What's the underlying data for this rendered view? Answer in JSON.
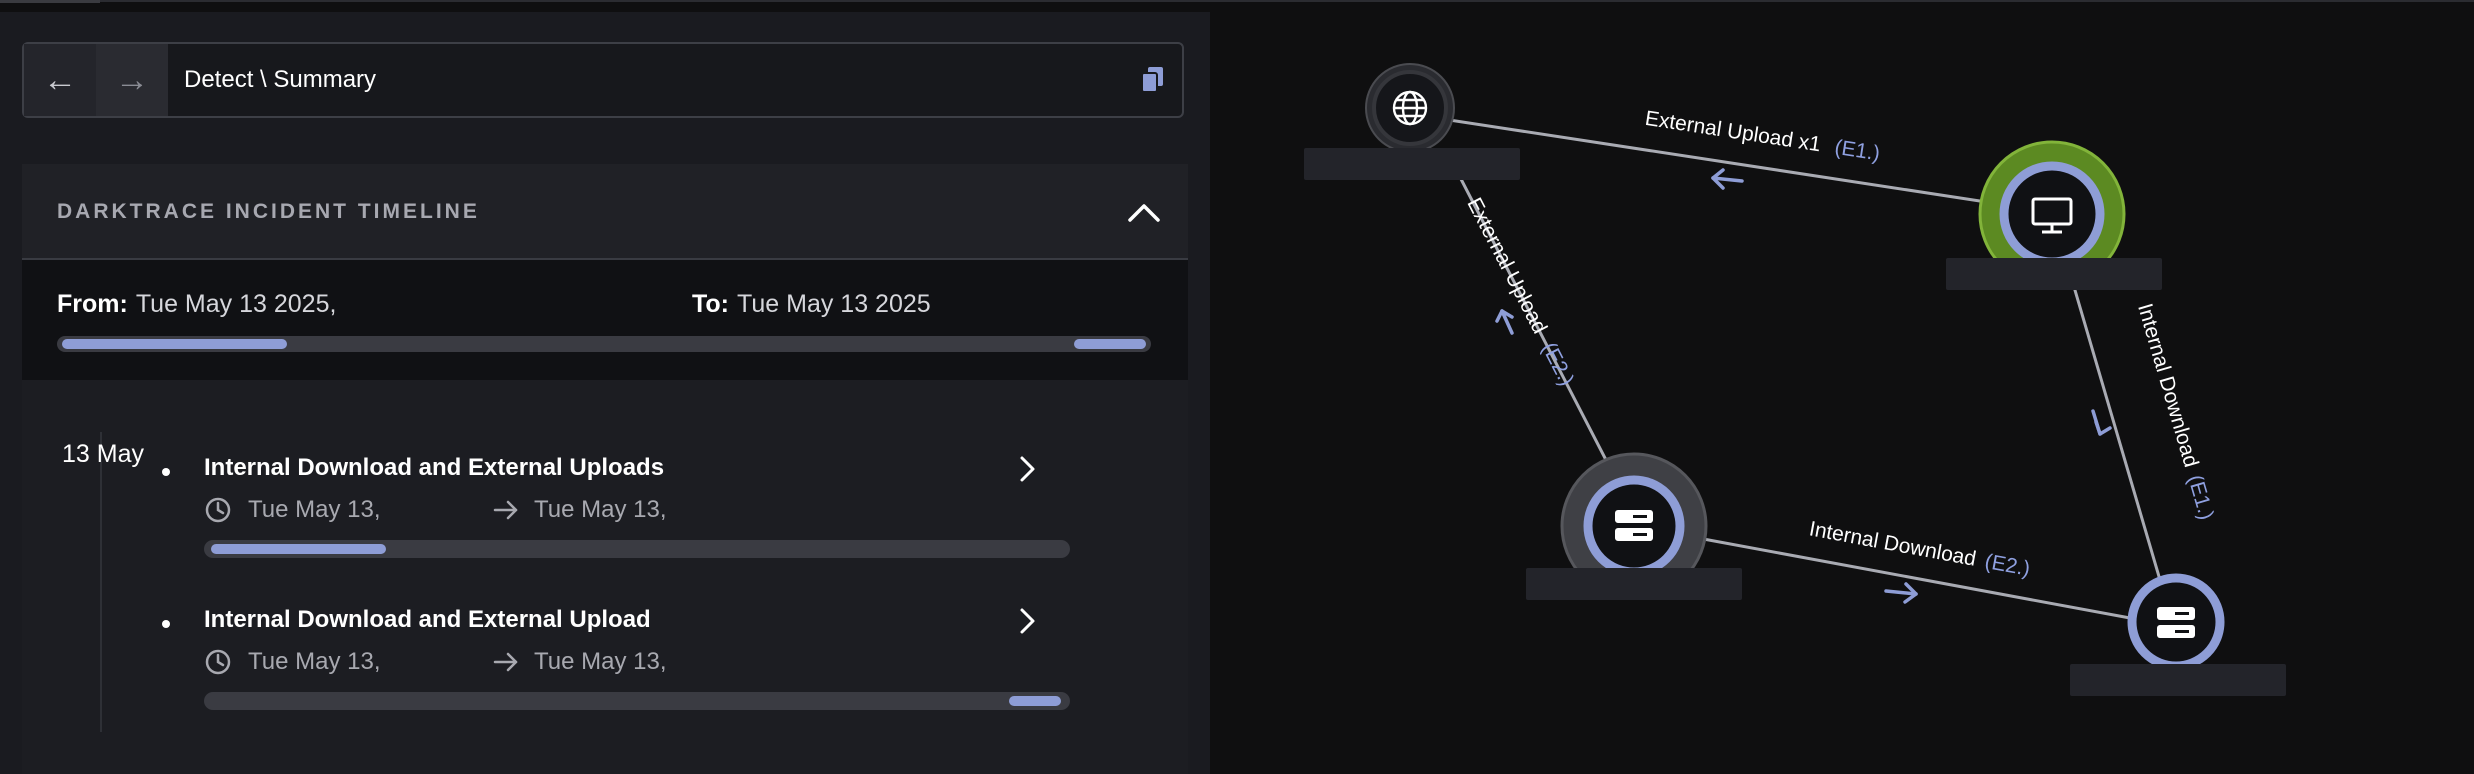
{
  "nav": {
    "back_icon": "arrow-left-icon",
    "forward_icon": "arrow-right-icon",
    "path": "Detect \\ Summary",
    "copy_icon": "copy-icon"
  },
  "timeline_card": {
    "title": "DARKTRACE INCIDENT TIMELINE",
    "collapse_icon": "chevron-up-icon",
    "from_label": "From:",
    "from_value": "Tue May 13 2025,",
    "to_label": "To:",
    "to_value": "Tue May 13 2025",
    "range_segments_pct": [
      [
        0.5,
        21
      ],
      [
        93,
        99.5
      ]
    ],
    "date_group": "13 May",
    "items": [
      {
        "title": "Internal Download and External Uploads",
        "start": "Tue May 13,",
        "end": "Tue May 13,",
        "segment_pct": [
          0.8,
          21
        ]
      },
      {
        "title": "Internal Download and External Upload",
        "start": "Tue May 13,",
        "end": "Tue May 13,",
        "segment_pct": [
          93,
          99
        ]
      }
    ]
  },
  "graph": {
    "colors": {
      "edge": "#a9abb3",
      "edge_label": "#ffffff",
      "edge_code": "#8fa0e0",
      "node_ring": "#8e9dd6",
      "node_halo_green": "#6f9e2b",
      "node_halo_gray": "#4a4b50"
    },
    "edges": [
      {
        "text": "External Upload x1",
        "code": "(E1.)"
      },
      {
        "text": "External Upload",
        "code": "(E2.)"
      },
      {
        "text": "Internal Download",
        "code": "(E1.)"
      },
      {
        "text": "Internal Download",
        "code": "(E2.)"
      }
    ],
    "nodes": [
      {
        "icon": "globe-icon"
      },
      {
        "icon": "desktop-icon"
      },
      {
        "icon": "server-icon"
      },
      {
        "icon": "server-icon"
      }
    ]
  }
}
